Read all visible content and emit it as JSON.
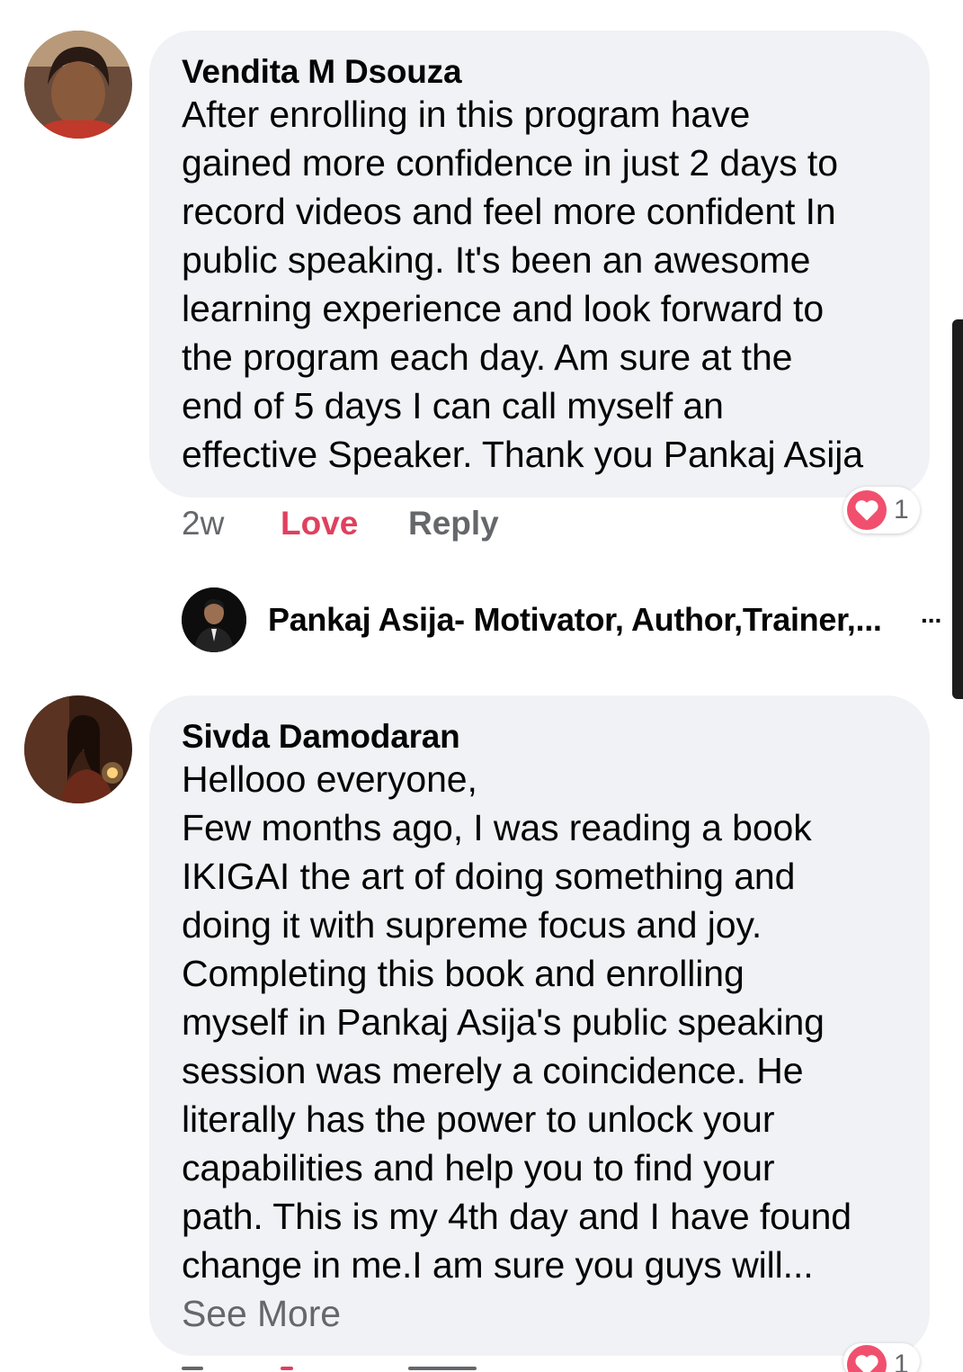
{
  "comments": [
    {
      "author": "Vendita M Dsouza",
      "lines": [
        "After enrolling in this program have",
        "gained more confidence in just 2 days to",
        "record videos and feel more confident In",
        "public speaking. It's been an awesome",
        "learning experience and look forward to",
        "the program each day. Am sure at the",
        "end of 5 days I can call myself an",
        "effective Speaker. Thank you Pankaj Asija"
      ],
      "time": "2w",
      "love_label": "Love",
      "reply_label": "Reply",
      "reaction_count": "1",
      "reply_preview": {
        "name": "Pankaj Asija- Motivator, Author,Trainer,...",
        "more": "..."
      }
    },
    {
      "author": "Sivda Damodaran",
      "lines": [
        "Hellooo everyone,",
        "Few months ago, I was reading a book",
        "IKIGAI the art of doing something and",
        "doing it with supreme focus and joy.",
        "Completing this book and enrolling",
        "myself in Pankaj Asija's public speaking",
        "session was merely a coincidence. He",
        "literally has the power to unlock your",
        "capabilities and help you to find your",
        "path. This is my 4th day and I have found",
        "change in me.I am sure you guys will..."
      ],
      "see_more": "See More",
      "reaction_count": "1"
    }
  ],
  "colors": {
    "bubble": "#f0f2f5",
    "love": "#e0405e",
    "meta": "#65676b",
    "heart": "#f0506e"
  }
}
